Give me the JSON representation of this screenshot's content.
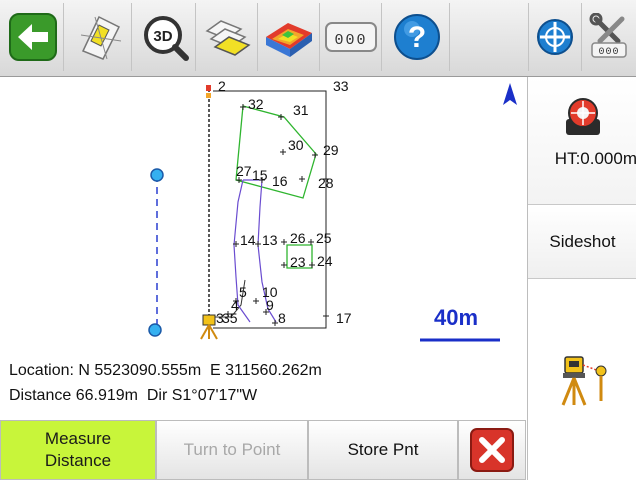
{
  "toolbar": {
    "buttons": [
      {
        "name": "back",
        "icon": "back-arrow-icon"
      },
      {
        "name": "plan-view",
        "icon": "plan-sheet-icon"
      },
      {
        "name": "3d-view",
        "icon": "3d-view-icon",
        "label": "3D"
      },
      {
        "name": "layers",
        "icon": "layers-icon"
      },
      {
        "name": "surface",
        "icon": "surface-map-icon"
      },
      {
        "name": "codes",
        "icon": "keypad-icon",
        "label": "000"
      },
      {
        "name": "help",
        "icon": "help-icon",
        "label": "?"
      },
      {
        "name": "map-center",
        "icon": "crosshair-globe-icon"
      },
      {
        "name": "settings",
        "icon": "tools-icon",
        "label": "000"
      }
    ]
  },
  "map": {
    "north_label": "N",
    "scale_label": "40m",
    "point_labels": [
      {
        "id": "2",
        "text": "2"
      },
      {
        "id": "33",
        "text": "33"
      },
      {
        "id": "32",
        "text": "32"
      },
      {
        "id": "31",
        "text": "31"
      },
      {
        "id": "30",
        "text": "30"
      },
      {
        "id": "29",
        "text": "29"
      },
      {
        "id": "27",
        "text": "27"
      },
      {
        "id": "15",
        "text": "15"
      },
      {
        "id": "16",
        "text": "16"
      },
      {
        "id": "28",
        "text": "28"
      },
      {
        "id": "14",
        "text": "14"
      },
      {
        "id": "13",
        "text": "13"
      },
      {
        "id": "26",
        "text": "26"
      },
      {
        "id": "25",
        "text": "25"
      },
      {
        "id": "23",
        "text": "23"
      },
      {
        "id": "24",
        "text": "24"
      },
      {
        "id": "5",
        "text": "5"
      },
      {
        "id": "10",
        "text": "10"
      },
      {
        "id": "4",
        "text": "4"
      },
      {
        "id": "9",
        "text": "9"
      },
      {
        "id": "3",
        "text": "3"
      },
      {
        "id": "35",
        "text": "35"
      },
      {
        "id": "8",
        "text": "8"
      },
      {
        "id": "17",
        "text": "17"
      }
    ]
  },
  "panel": {
    "ht_label": "HT:0.000m",
    "sideshot_label": "Sideshot"
  },
  "info": {
    "location_line": "Location: N 5523090.555m  E 311560.262m",
    "distance_line": "Distance 66.919m  Dir S1°07'17\"W"
  },
  "bottom": {
    "measure_line1": "Measure",
    "measure_line2": "Distance",
    "turn_label": "Turn to Point",
    "store_label": "Store Pnt"
  },
  "colors": {
    "accent_green": "#c8f53a",
    "back_green": "#3a9a2a",
    "help_blue": "#1e7fd0",
    "scale_blue": "#1a2fc8",
    "close_red": "#d8342a",
    "polygon_green": "#2fb52f",
    "dashed_blue": "#2a3fd0",
    "node_cyan": "#2a9ae0"
  }
}
